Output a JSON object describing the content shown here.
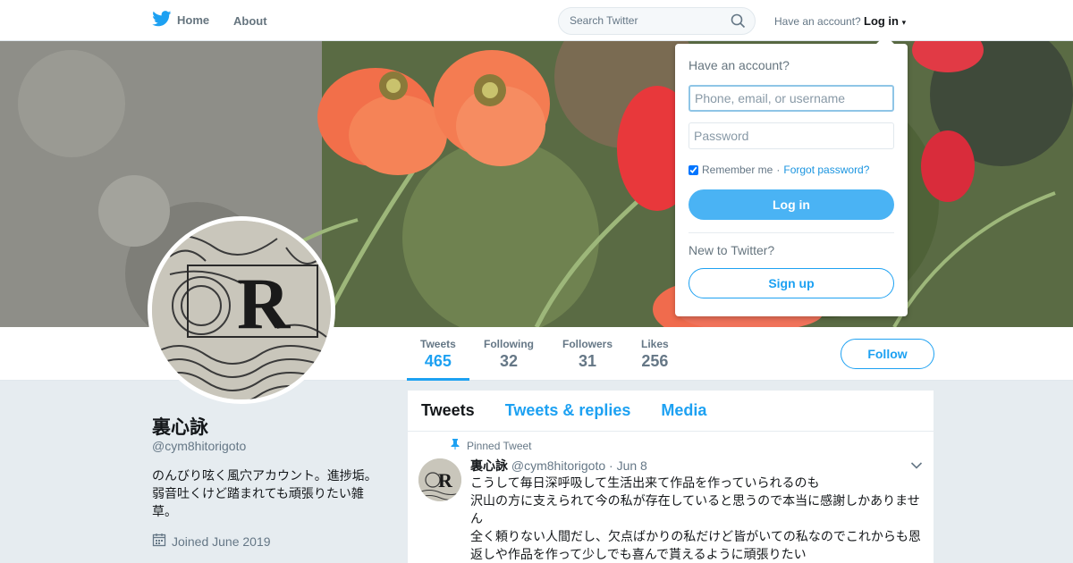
{
  "nav": {
    "home_label": "Home",
    "about_label": "About",
    "search_placeholder": "Search Twitter",
    "have_account": "Have an account?",
    "login_label": "Log in"
  },
  "profile": {
    "name": "裏心詠",
    "handle": "@cym8hitorigoto",
    "bio": "のんびり呟く風穴アカウント。進捗垢。弱音吐くけど踏まれても頑張りたい雑草。",
    "joined": "Joined June 2019"
  },
  "stats": [
    {
      "label": "Tweets",
      "value": "465"
    },
    {
      "label": "Following",
      "value": "32"
    },
    {
      "label": "Followers",
      "value": "31"
    },
    {
      "label": "Likes",
      "value": "256"
    }
  ],
  "follow_label": "Follow",
  "tabs": [
    "Tweets",
    "Tweets & replies",
    "Media"
  ],
  "tweet": {
    "pinned_label": "Pinned Tweet",
    "name": "裏心詠",
    "handle": "@cym8hitorigoto",
    "date": "· Jun 8",
    "lines": [
      "こうして毎日深呼吸して生活出来て作品を作っていられるのも",
      "沢山の方に支えられて今の私が存在していると思うので本当に感謝しかありませ",
      "ん",
      "全く頼りない人間だし、欠点ばかりの私だけど皆がいての私なのでこれからも恩",
      "返しや作品を作って少しでも喜んで貰えるように頑張りたい"
    ]
  },
  "login_dropdown": {
    "title": "Have an account?",
    "username_placeholder": "Phone, email, or username",
    "password_placeholder": "Password",
    "remember_label": "Remember me",
    "forgot_label": "Forgot password?",
    "login_button": "Log in",
    "new_label": "New to Twitter?",
    "signup_button": "Sign up"
  },
  "colors": {
    "accent": "#1da1f2",
    "login_button": "#4ab3f4",
    "background": "#e6ecf0"
  }
}
